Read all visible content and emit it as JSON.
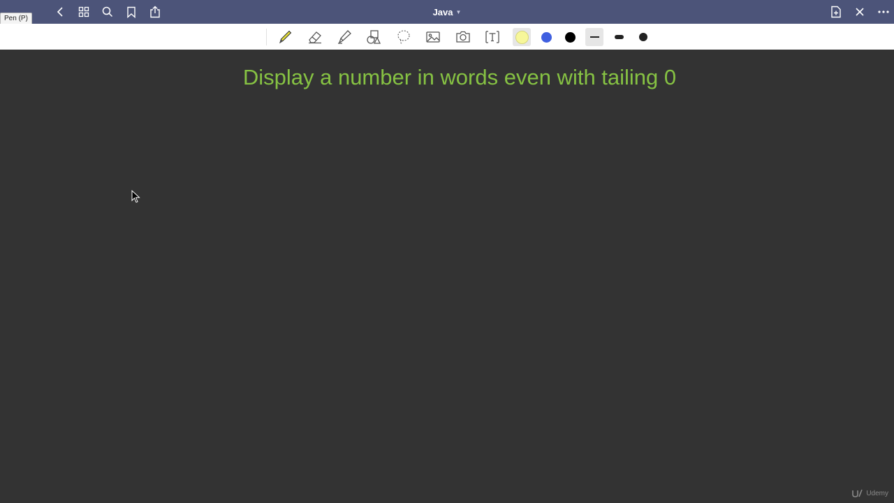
{
  "titlebar": {
    "document_title": "Java",
    "tooltip": "Pen (P)",
    "left_icons": [
      "back-icon",
      "grid-icon",
      "search-icon",
      "bookmark-icon",
      "share-icon"
    ],
    "right_icons": [
      "new-page-icon",
      "close-icon",
      "more-icon"
    ]
  },
  "toolbar": {
    "tools": [
      "pen",
      "eraser",
      "highlighter",
      "shapes",
      "lasso",
      "image",
      "camera",
      "text-box"
    ],
    "selected_tool": "pen",
    "colors": [
      "#f7f79a",
      "#3f5fe0",
      "#000000"
    ],
    "stroke_sizes": [
      "thin",
      "medium",
      "thick"
    ],
    "selected_stroke": "thin"
  },
  "canvas": {
    "heading": "Display a number in words even with tailing 0",
    "heading_color": "#86c243",
    "background": "#333333"
  },
  "watermark": {
    "text": "Udemy"
  }
}
